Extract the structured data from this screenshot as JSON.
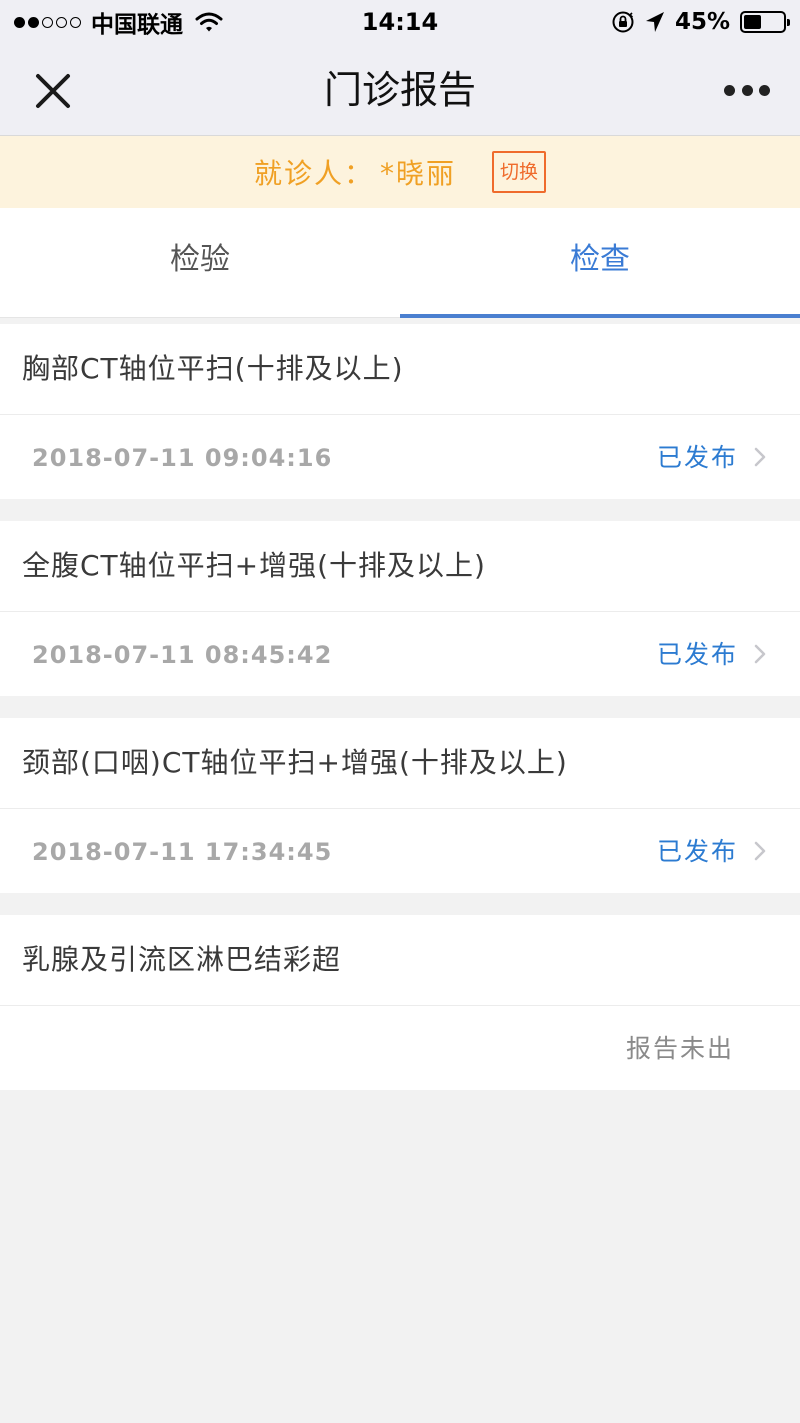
{
  "status_bar": {
    "carrier": "中国联通",
    "time": "14:14",
    "battery_percent": "45%",
    "battery_level": 0.45,
    "signal_bars_filled": 2,
    "signal_bars_total": 5
  },
  "nav": {
    "title": "门诊报告"
  },
  "patient": {
    "label": "就诊人：",
    "name": "*晓丽",
    "switch_label": "切换"
  },
  "tabs": [
    {
      "label": "检验",
      "active": false
    },
    {
      "label": "检查",
      "active": true
    }
  ],
  "reports": [
    {
      "title": "胸部CT轴位平扫(十排及以上)",
      "time": "2018-07-11 09:04:16",
      "status": "已发布"
    },
    {
      "title": "全腹CT轴位平扫+增强(十排及以上)",
      "time": "2018-07-11 08:45:42",
      "status": "已发布"
    },
    {
      "title": "颈部(口咽)CT轴位平扫+增强(十排及以上)",
      "time": "2018-07-11 17:34:45",
      "status": "已发布"
    },
    {
      "title": "乳腺及引流区淋巴结彩超",
      "time": "",
      "status": "报告未出"
    }
  ],
  "colors": {
    "accent_blue": "#3a7bd5",
    "patient_orange": "#f0a024",
    "switch_orange": "#ef6b2c",
    "banner_bg": "#fdf3dd",
    "status_published": "#2c7bd1"
  }
}
